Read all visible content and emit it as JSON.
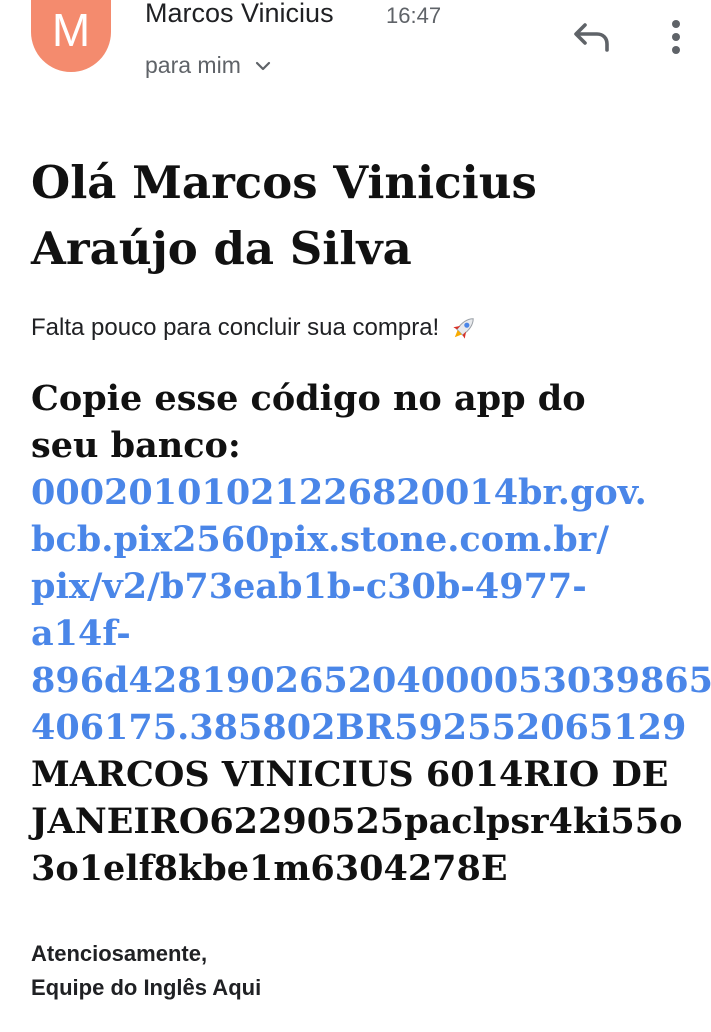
{
  "header": {
    "avatar_letter": "M",
    "avatar_color": "#f48b6e",
    "sender": "Marcos Vinicius",
    "time": "16:47",
    "recipient": "para mim",
    "icons": [
      "chevron-down-icon",
      "reply-icon",
      "more-vert-icon"
    ]
  },
  "body": {
    "greeting_line1": "Olá Marcos Vinicius",
    "greeting_line2": "Araújo da Silva",
    "subline": "Falta pouco para concluir sua compra!",
    "subline_icon": "rocket-icon",
    "copy_heading_line1": "Copie esse código no app do",
    "copy_heading_line2": "seu banco:",
    "pix_link_lines": [
      "00020101021226820014br.gov.",
      "bcb.pix2560pix.stone.com.br/",
      "pix/v2/b73eab1b-c30b-4977-",
      "a14f-",
      "896d428190265204000053039865",
      "406175.385802BR592552065129"
    ],
    "pix_text_lines": [
      "MARCOS VINICIUS 6014RIO DE",
      "JANEIRO62290525paclpsr4ki55o",
      "3o1elf8kbe1m6304278E"
    ],
    "link_color": "#4a86e8"
  },
  "signature": {
    "line1": "Atenciosamente,",
    "line2": "Equipe do Inglês Aqui"
  }
}
